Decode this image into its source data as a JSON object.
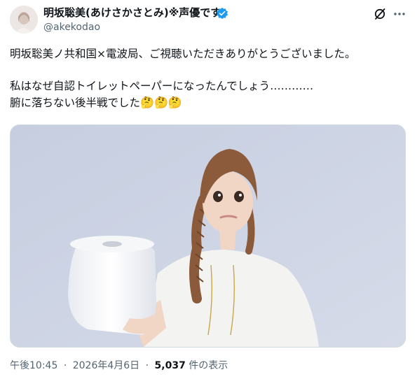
{
  "author": {
    "display_name": "明坂聡美(あけさかさとみ)※声優です",
    "handle": "@akekodao",
    "verified_color": "#1d9bf0",
    "avatar_icon": "avatar-photo"
  },
  "actions": {
    "grok_icon": "grok-icon",
    "more_icon": "more-icon"
  },
  "tweet": {
    "line1": "明坂聡美ノ共和国×電波局、ご視聴いただきありがとうございました。",
    "line2": "私はなぜ自認トイレットペーパーになったんでしょう…………",
    "line3": "腑に落ちない後半戦でした",
    "line3_emoji": "🤔🤔🤔"
  },
  "media": {
    "description_icon": "photo-woman-holding-toilet-paper"
  },
  "meta": {
    "time": "午後10:45",
    "date": "2026年4月6日",
    "views_count": "5,037",
    "views_label": "件の表示",
    "separator": "·"
  },
  "colors": {
    "text": "#0f1419",
    "secondary": "#536471",
    "border": "#cfd9de",
    "accent": "#1d9bf0"
  }
}
